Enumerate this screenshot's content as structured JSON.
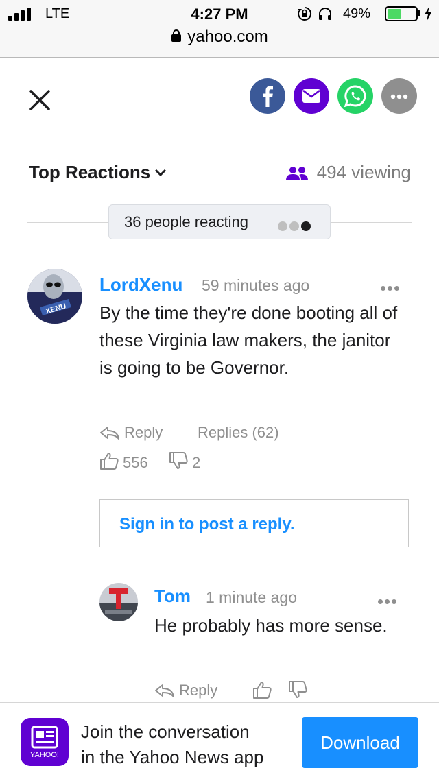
{
  "status_bar": {
    "carrier": "LTE",
    "time": "4:27 PM",
    "battery_percent": "49%",
    "battery_level": 0.49
  },
  "browser": {
    "url": "yahoo.com"
  },
  "share": {
    "icons": [
      "close-icon",
      "facebook-icon",
      "mail-icon",
      "whatsapp-icon",
      "more-icon"
    ],
    "colors": {
      "facebook": "#3b5998",
      "mail": "#6001d2",
      "whatsapp": "#25d366",
      "more": "#8f8f8f"
    }
  },
  "reactions": {
    "sort_label": "Top Reactions",
    "viewing": "494 viewing",
    "reacting": "36 people reacting"
  },
  "comments": [
    {
      "username": "LordXenu",
      "time": "59 minutes ago",
      "text": "By the time they're done booting all of these Virginia law makers, the janitor is going to be Governor.",
      "reply_label": "Reply",
      "replies_label": "Replies (62)",
      "likes": "556",
      "dislikes": "2"
    }
  ],
  "signin": {
    "label": "Sign in to post a reply."
  },
  "replies": [
    {
      "username": "Tom",
      "time": "1 minute ago",
      "text": "He probably has more sense.",
      "reply_label": "Reply"
    }
  ],
  "banner": {
    "icon_label": "YAHOO!",
    "line1": "Join the conversation",
    "line2": "in the Yahoo News app",
    "download_label": "Download"
  },
  "colors": {
    "link_blue": "#188fff",
    "yahoo_purple": "#6001d2",
    "muted": "#8f8f8f"
  }
}
